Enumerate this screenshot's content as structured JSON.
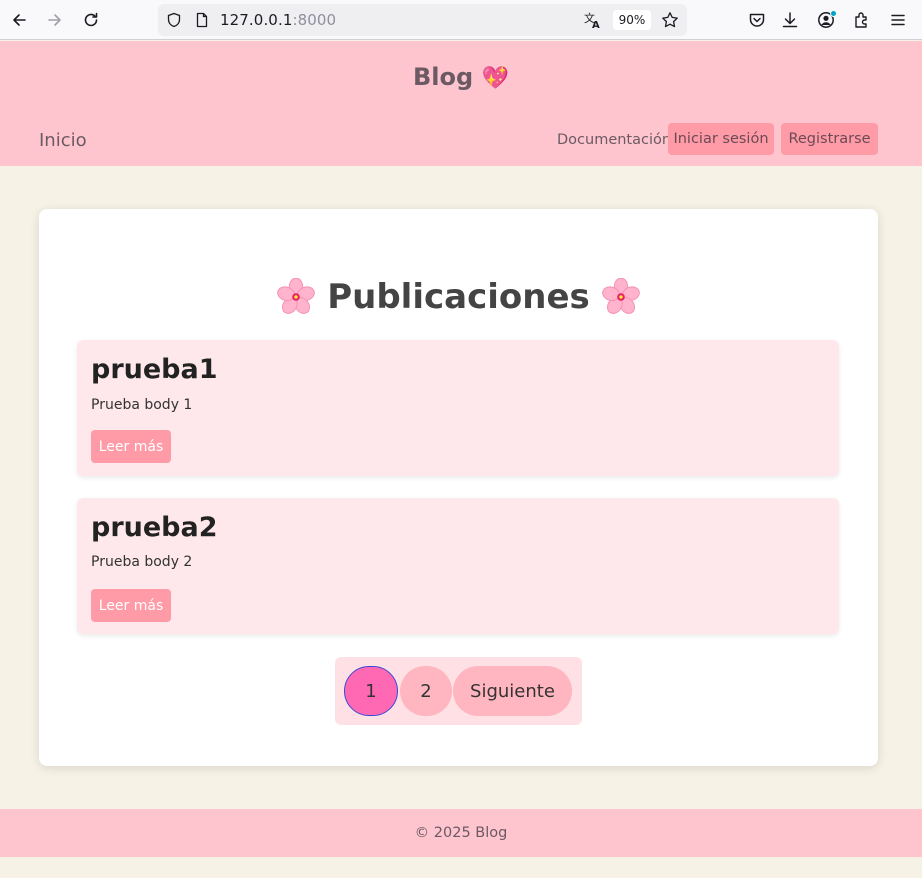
{
  "browser": {
    "url_host": "127.0.0.1",
    "url_port": ":8000",
    "zoom": "90%",
    "icons": [
      "back-icon",
      "forward-icon",
      "reload-icon",
      "shield-icon",
      "page-icon",
      "translate-icon",
      "bookmark-star-icon",
      "pocket-icon",
      "download-icon",
      "account-icon",
      "extensions-icon",
      "menu-icon"
    ]
  },
  "header": {
    "title": "Blog",
    "title_emoji": "💖",
    "nav": {
      "home": "Inicio",
      "docs": "Documentación",
      "login": "Iniciar sesión",
      "register": "Registrarse"
    }
  },
  "main": {
    "heading": "Publicaciones",
    "heading_icon": "cherry-blossom-icon",
    "posts": [
      {
        "title": "prueba1",
        "body": "Prueba body 1",
        "button": "Leer más"
      },
      {
        "title": "prueba2",
        "body": "Prueba body 2",
        "button": "Leer más"
      }
    ],
    "pagination": {
      "pages": [
        "1",
        "2"
      ],
      "current": "1",
      "next": "Siguiente"
    }
  },
  "footer": {
    "text": "© 2025 Blog"
  },
  "colors": {
    "header_bg": "#ffc5cf",
    "page_bg": "#f6f2e6",
    "accent_button": "#ff9aa7",
    "post_bg": "#ffe8ec",
    "active_page": "#ff69b4",
    "page_button": "#ffb6c1"
  }
}
